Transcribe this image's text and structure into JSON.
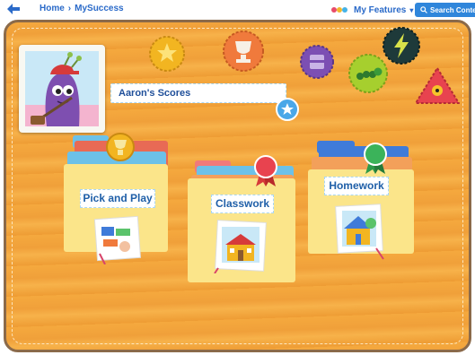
{
  "breadcrumb": {
    "home": "Home",
    "separator": "›",
    "current": "MySuccess"
  },
  "header": {
    "features_label": "My Features",
    "features_caret": "▾",
    "search_label": "Search Conte"
  },
  "profile": {
    "title": "Aaron's Scores"
  },
  "folders": [
    {
      "label": "Pick and Play",
      "icon": "pick-and-play-icon",
      "badge": "trophy-badge"
    },
    {
      "label": "Classwork",
      "icon": "schoolhouse-icon",
      "badge": "ribbon-badge"
    },
    {
      "label": "Homework",
      "icon": "house-icon",
      "badge": "green-ribbon-badge"
    }
  ],
  "badges": [
    "star-badge",
    "trophy-badge",
    "book-badge",
    "lightning-badge",
    "caterpillar-badge",
    "bug-triangle-badge",
    "small-star-badge"
  ],
  "colors": {
    "board": "#f5a93e",
    "link": "#2a6ac9",
    "folder": "#fbe58a",
    "accent_blue": "#2f86db"
  }
}
